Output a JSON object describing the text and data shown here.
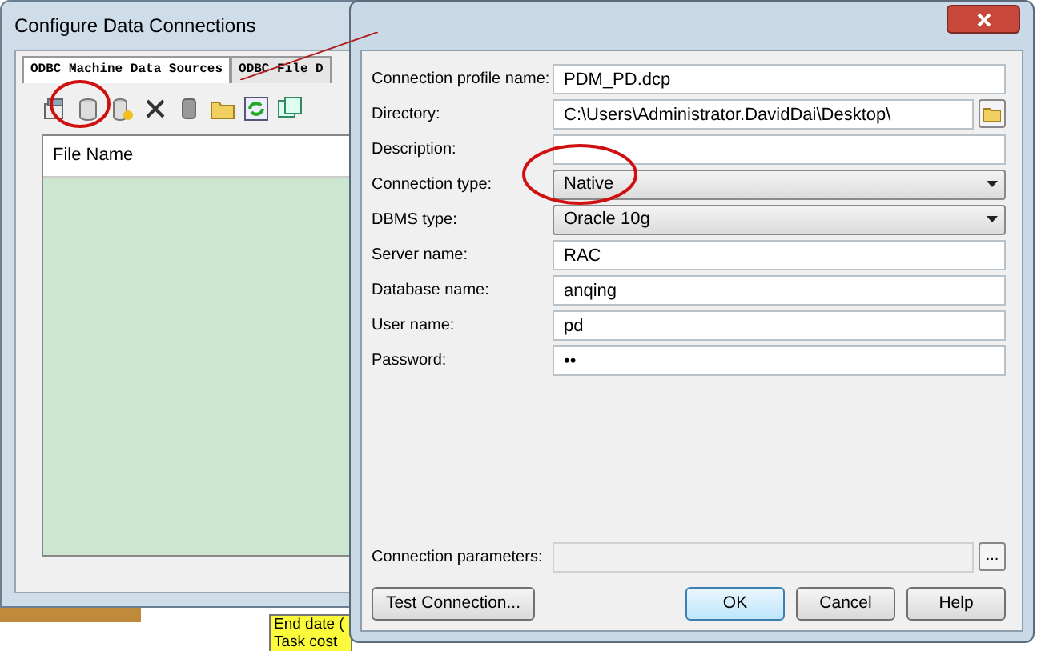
{
  "back_window": {
    "title": "Configure Data Connections",
    "tabs": [
      {
        "label": "ODBC Machine Data Sources",
        "selected": true
      },
      {
        "label": "ODBC File D",
        "selected": false
      }
    ],
    "list": {
      "columns": [
        "File Name"
      ]
    }
  },
  "dialog": {
    "fields": [
      {
        "kind": "text",
        "label": "Connection profile name:",
        "value": "PDM_PD.dcp"
      },
      {
        "kind": "browse",
        "label": "Directory:",
        "value": "C:\\Users\\Administrator.DavidDai\\Desktop\\"
      },
      {
        "kind": "text",
        "label": "Description:"
      },
      {
        "kind": "dropdown",
        "label": "Connection type:",
        "value": "Native"
      },
      {
        "kind": "dropdown",
        "label": "DBMS type:",
        "value": "Oracle 10g"
      },
      {
        "kind": "text",
        "label": "Server name:",
        "value": "RAC"
      },
      {
        "kind": "text",
        "label": "Database name:",
        "value": "anqing"
      },
      {
        "kind": "text",
        "label": "User name:",
        "value": "pd"
      },
      {
        "kind": "password",
        "label": "Password:",
        "value": "••"
      }
    ],
    "connection_parameters": {
      "label": "Connection parameters:",
      "button": "..."
    },
    "buttons": [
      {
        "label": "Test Connection...",
        "default": false
      },
      {
        "label": "OK",
        "default": true
      },
      {
        "label": "Cancel",
        "default": false
      },
      {
        "label": "Help",
        "default": false
      }
    ]
  },
  "background_note": {
    "lines": [
      "End date (",
      "Task cost"
    ]
  }
}
